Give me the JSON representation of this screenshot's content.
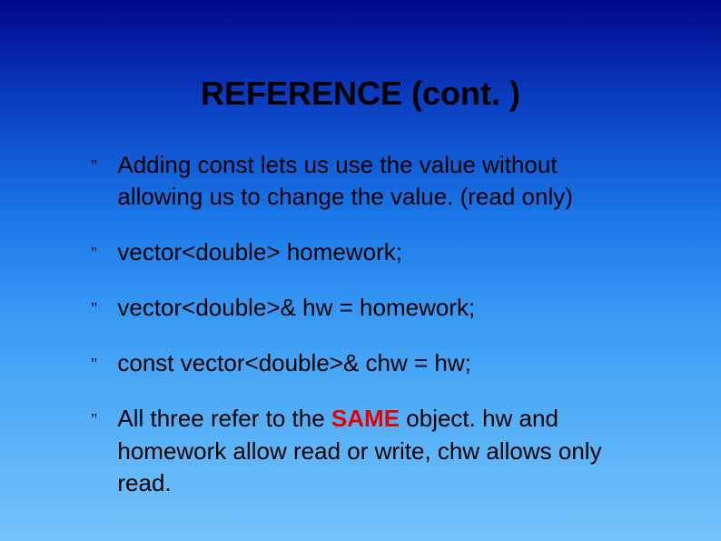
{
  "title": "REFERENCE (cont. )",
  "bullets": {
    "b0": "Adding const lets us use the value without allowing us to change the value.  (read only)",
    "b1": "vector<double> homework;",
    "b2": "vector<double>& hw = homework;",
    "b3": "const vector<double>& chw = hw;",
    "b4_pre": "All three refer to the ",
    "b4_em": "SAME",
    "b4_post": " object.  hw and homework allow read or write, chw allows only read."
  },
  "marker": "\""
}
